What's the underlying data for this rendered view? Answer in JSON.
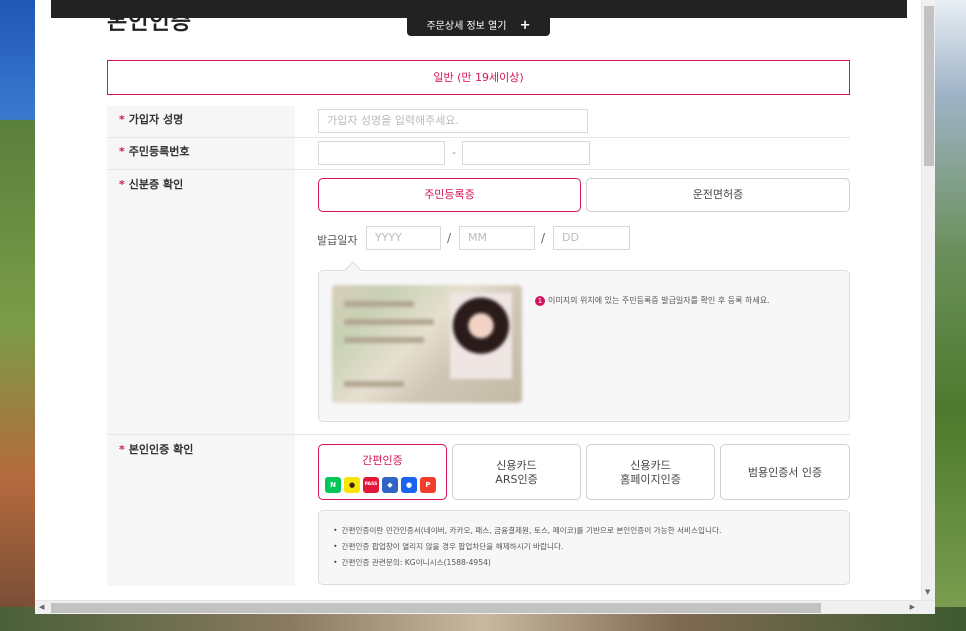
{
  "page": {
    "title": "본인인증",
    "detail_toggle": "주문상세 정보 열기",
    "detail_toggle_icon": "plus-icon",
    "group_label": "일반 (만 19세이상)"
  },
  "form": {
    "name_label": "가입자 성명",
    "name_placeholder": "가입자 성명을 입력해주세요.",
    "rrn_label": "주민등록번호",
    "rrn_dash": "-",
    "id_label": "신분증 확인",
    "id_options": [
      "주민등록증",
      "운전면허증"
    ],
    "id_selected": "주민등록증",
    "issue_label": "발급일자",
    "issue_placeholders": [
      "YYYY",
      "MM",
      "DD"
    ],
    "slash": "/",
    "id_note_number": "1",
    "id_note": "이미지의 위치에 있는 주민등록증 발급일자를 확인 후 등록 하세요.",
    "auth_label": "본인인증 확인",
    "auth_options": [
      {
        "line1": "간편인증",
        "line2": "",
        "active": true
      },
      {
        "line1": "신용카드",
        "line2": "ARS인증",
        "active": false
      },
      {
        "line1": "신용카드",
        "line2": "홈페이지인증",
        "active": false
      },
      {
        "line1": "범용인증서 인증",
        "line2": "",
        "active": false
      }
    ],
    "auth_apps": [
      {
        "name": "naver",
        "glyph": "N",
        "color": "#03c75a"
      },
      {
        "name": "kakao",
        "glyph": "●",
        "color": "#f7e600"
      },
      {
        "name": "pass",
        "glyph": "PASS",
        "color": "#e3173a"
      },
      {
        "name": "payment-institution",
        "glyph": "◆",
        "color": "#2f64c4"
      },
      {
        "name": "toss",
        "glyph": "●",
        "color": "#1b64f2"
      },
      {
        "name": "payco",
        "glyph": "P",
        "color": "#f23c2d"
      }
    ],
    "help_lines": [
      "간편인증이란 민간인증서(네이버, 카카오, 패스, 금융결제원, 토스, 페이코)를 기반으로 본인인증이 가능한 서비스입니다.",
      "간편인증 팝업창이 열리지 않을 경우 팝업차단을 해제하시기 바랍니다.",
      "간편인증 관련문의: KG이니시스(1588-4954)"
    ]
  },
  "colors": {
    "accent": "#d4145a",
    "topbar": "#222222"
  }
}
